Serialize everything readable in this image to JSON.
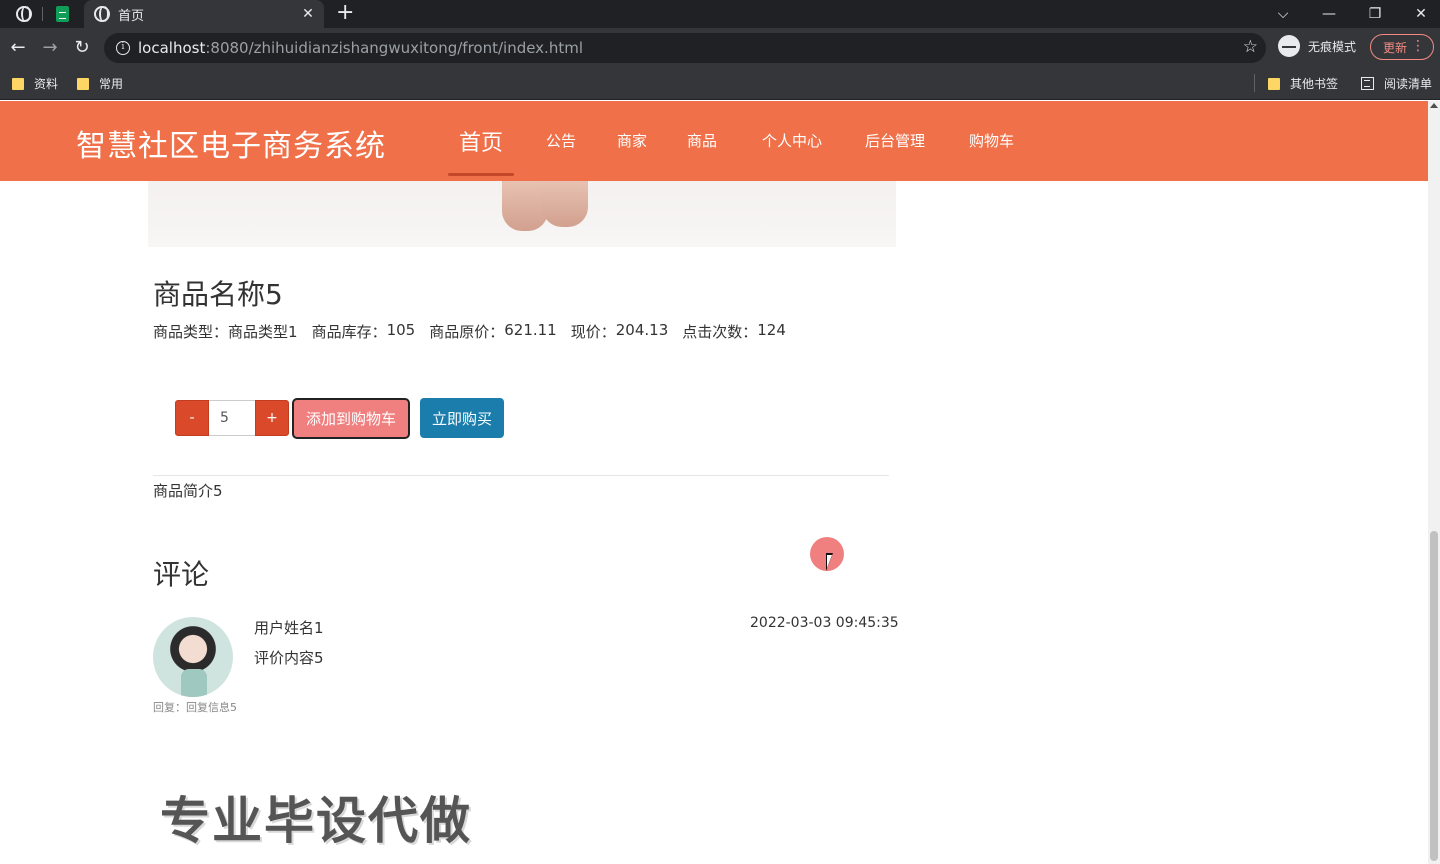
{
  "browser": {
    "tab_title": "首页",
    "url_host": "localhost",
    "url_rest": ":8080/zhihuidianzishangwuxitong/front/index.html",
    "incognito_label": "无痕模式",
    "update_label": "更新",
    "bookmarks": [
      "资料",
      "常用"
    ],
    "other_bookmarks": "其他书签",
    "reading_list": "阅读清单"
  },
  "site": {
    "brand": "智慧社区电子商务系统",
    "nav": [
      "首页",
      "公告",
      "商家",
      "商品",
      "个人中心",
      "后台管理",
      "购物车"
    ]
  },
  "product": {
    "name": "商品名称5",
    "type_label": "商品类型：",
    "type_value": "商品类型1",
    "stock_label": "商品库存：",
    "stock_value": "105",
    "orig_price_label": "商品原价：",
    "orig_price_value": "621.11",
    "price_label": "现价：",
    "price_value": "204.13",
    "clicks_label": "点击次数：",
    "clicks_value": "124",
    "quantity": "5",
    "minus_label": "-",
    "plus_label": "+",
    "add_to_cart": "添加到购物车",
    "buy_now": "立即购买",
    "intro": "商品简介5"
  },
  "comments": {
    "heading": "评论",
    "items": [
      {
        "user": "用户姓名1",
        "content": "评价内容5",
        "time": "2022-03-03 09:45:35",
        "reply": "回复：回复信息5"
      }
    ]
  },
  "watermark": "专业毕设代做"
}
